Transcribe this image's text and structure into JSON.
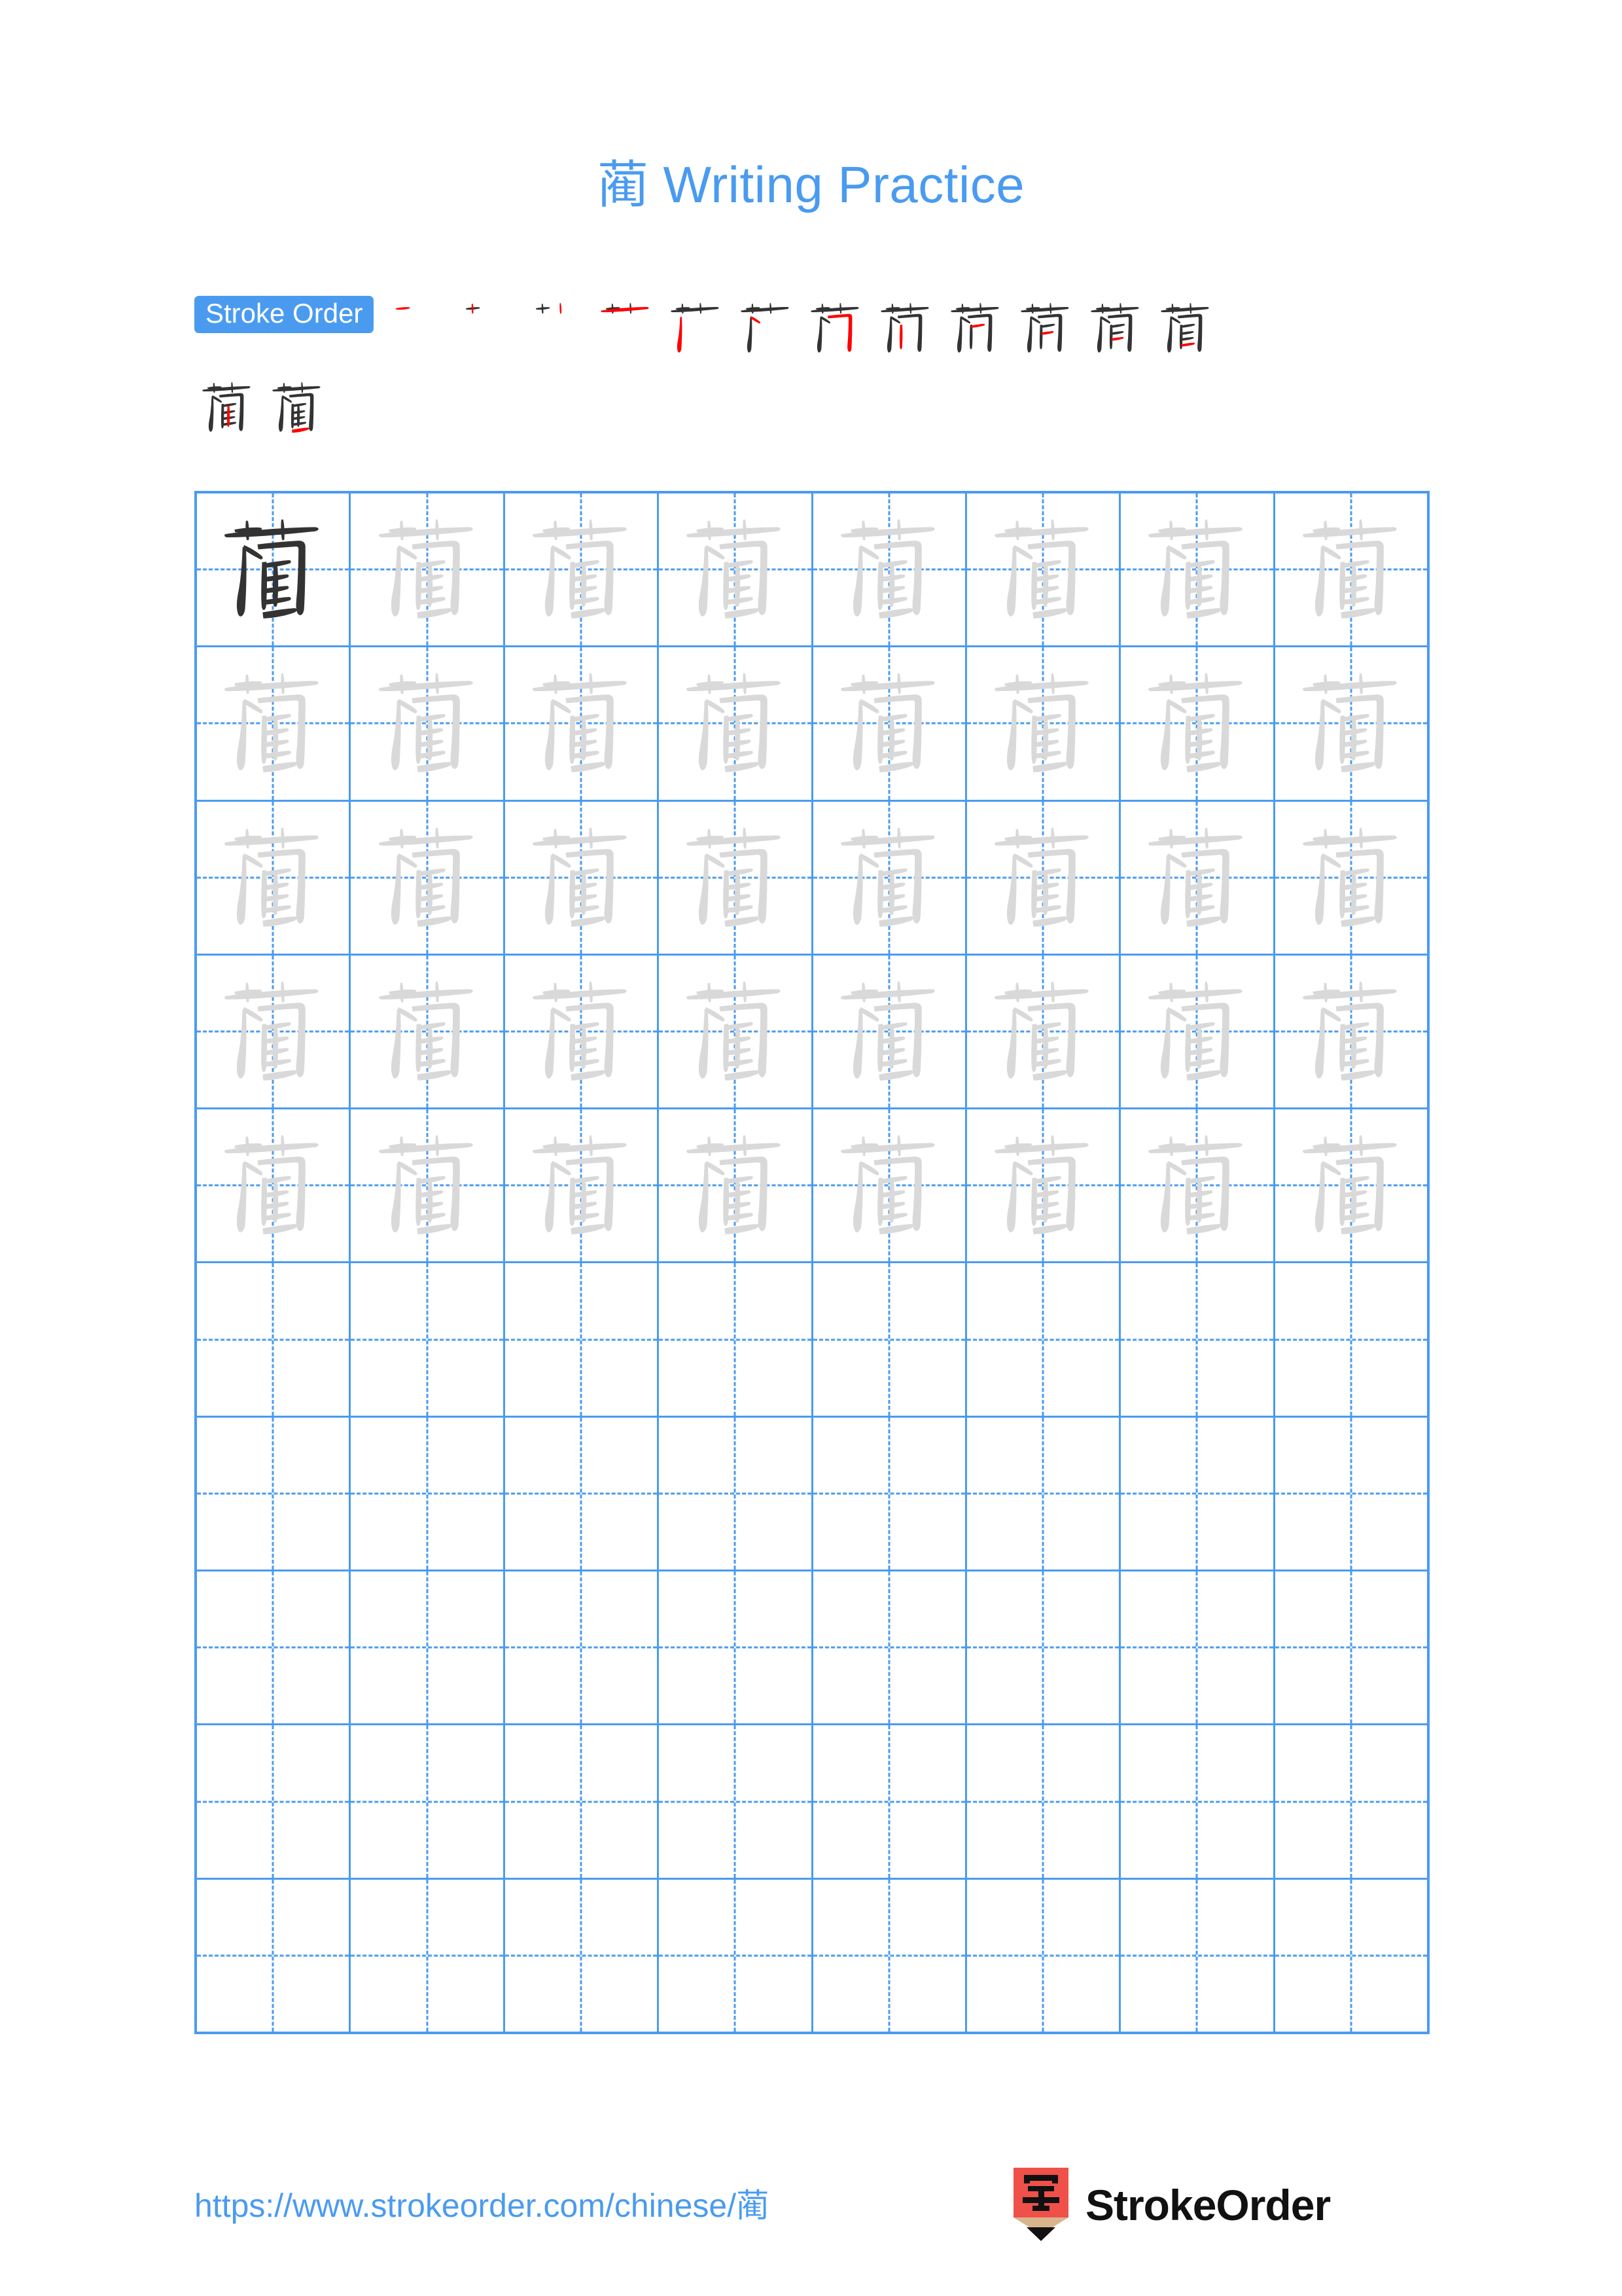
{
  "character": "蔺",
  "title": {
    "character": "蔺",
    "suffix": " Writing Practice",
    "full": "蔺 Writing Practice",
    "color": "#4a9bf0"
  },
  "stroke_order": {
    "badge_label": "Stroke Order",
    "badge_bg": "#4a9bf0",
    "badge_text_color": "#ffffff",
    "total_strokes": 14,
    "new_stroke_color": "#ff0000",
    "existing_stroke_color": "#333333",
    "steps_row1": 12,
    "steps_row2": 2,
    "step_numbers": [
      1,
      2,
      3,
      4,
      5,
      6,
      7,
      8,
      9,
      10,
      11,
      12,
      13,
      14
    ]
  },
  "grid": {
    "columns": 8,
    "rows": 10,
    "line_color": "#4a9bf0",
    "guide_style": "dashed",
    "model_char_color": "#333333",
    "trace_char_color": "#d9d9d9",
    "model_cells": 1,
    "traced_cells": 39,
    "blank_rows": 5,
    "rows_detail": [
      {
        "index": 1,
        "type": "model-and-trace",
        "model_index": 0,
        "traced": 7
      },
      {
        "index": 2,
        "type": "trace",
        "traced": 8
      },
      {
        "index": 3,
        "type": "trace",
        "traced": 8
      },
      {
        "index": 4,
        "type": "trace",
        "traced": 8
      },
      {
        "index": 5,
        "type": "trace",
        "traced": 8
      },
      {
        "index": 6,
        "type": "blank",
        "traced": 0
      },
      {
        "index": 7,
        "type": "blank",
        "traced": 0
      },
      {
        "index": 8,
        "type": "blank",
        "traced": 0
      },
      {
        "index": 9,
        "type": "blank",
        "traced": 0
      },
      {
        "index": 10,
        "type": "blank",
        "traced": 0
      }
    ]
  },
  "footer": {
    "url": "https://www.strokeorder.com/chinese/蔺",
    "url_color": "#4a9bf0",
    "brand_name": "StrokeOrder",
    "logo_char": "字",
    "logo_body_color": "#f0504a",
    "logo_wood_color": "#d9b58c",
    "logo_tip_color": "#111111"
  }
}
